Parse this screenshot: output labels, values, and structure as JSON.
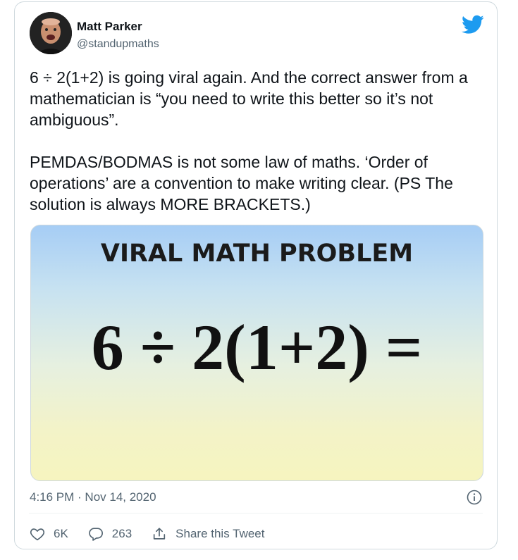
{
  "author": {
    "name": "Matt Parker",
    "handle": "@standupmaths"
  },
  "tweet": {
    "paragraphs": [
      "6 ÷ 2(1+2) is going viral again. And the correct answer from a mathematician is “you need to write this better so it’s not ambiguous”.",
      "PEMDAS/BODMAS is not some law of maths. ‘Order of operations’ are a convention to make writing clear. (PS The solution is always MORE BRACKETS.)"
    ],
    "timestamp": "4:16 PM · Nov 14, 2020"
  },
  "media": {
    "title": "VIRAL MATH PROBLEM",
    "equation": "6 ÷ 2(1+2) ="
  },
  "actions": {
    "likes": "6K",
    "replies": "263",
    "share_label": "Share this Tweet"
  },
  "colors": {
    "twitter_blue": "#1d9bf0",
    "text_primary": "#0f1419",
    "text_secondary": "#536471",
    "border": "#cfd9de"
  },
  "icons": {
    "brand": "twitter-bird-icon",
    "info": "info-icon",
    "like": "heart-icon",
    "reply": "reply-icon",
    "share": "share-icon"
  }
}
